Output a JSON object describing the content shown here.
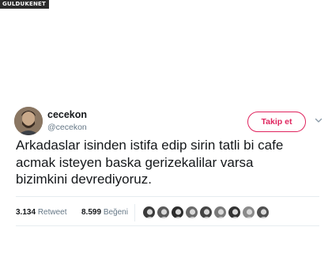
{
  "watermark": "GULDUKENET",
  "tweet": {
    "author": {
      "display_name": "cecekon",
      "handle": "@cecekon",
      "avatar_icon": "profile-photo"
    },
    "follow_button_label": "Takip et",
    "menu_icon": "chevron-down-icon",
    "lines": [
      "Arkadaslar isinden istifa edip sirin tatli bi cafe",
      "acmak isteyen baska gerizekalilar varsa",
      "bizimkini devrediyoruz."
    ],
    "stats": {
      "retweet_count": "3.134",
      "retweet_label": "Retweet",
      "like_count": "8.599",
      "like_label": "Beğeni"
    },
    "liker_avatars": [
      {
        "name": "liker-avatar-1",
        "color": "#3a3a3a"
      },
      {
        "name": "liker-avatar-2",
        "color": "#5a5a5a"
      },
      {
        "name": "liker-avatar-3",
        "color": "#2c2c2c"
      },
      {
        "name": "liker-avatar-4",
        "color": "#6a6a6a"
      },
      {
        "name": "liker-avatar-5",
        "color": "#444444"
      },
      {
        "name": "liker-avatar-6",
        "color": "#7a7a7a"
      },
      {
        "name": "liker-avatar-7",
        "color": "#333333"
      },
      {
        "name": "liker-avatar-8",
        "color": "#8a8a8a"
      },
      {
        "name": "liker-avatar-9",
        "color": "#505050"
      }
    ],
    "colors": {
      "follow_accent": "#e0245e",
      "secondary_text": "#657786",
      "divider": "#e6ecf0"
    }
  }
}
